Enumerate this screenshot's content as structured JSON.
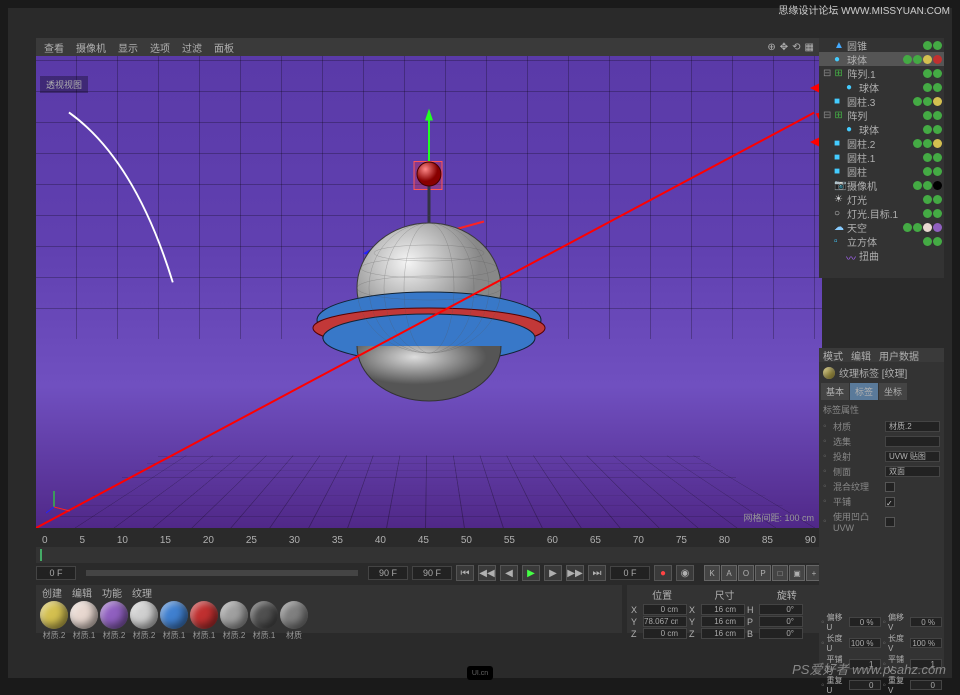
{
  "watermarks": {
    "top_right": "思缘设计论坛 WWW.MISSYUAN.COM",
    "bottom_right": "PS爱好者 www.psahz.com",
    "bottom_center": "UI.cn"
  },
  "menubar": {
    "items": [
      "查看",
      "摄像机",
      "显示",
      "选项",
      "过滤",
      "面板"
    ]
  },
  "viewport": {
    "label": "透视视图",
    "grid_info": "网格间距: 100 cm"
  },
  "timeline": {
    "start": "0 F",
    "end": "90 F",
    "current": "0 F",
    "ticks": [
      "0",
      "5",
      "10",
      "15",
      "20",
      "25",
      "30",
      "35",
      "40",
      "45",
      "50",
      "55",
      "60",
      "65",
      "70",
      "75",
      "80",
      "85",
      "90"
    ]
  },
  "playback_toggles": [
    "K",
    "A",
    "O",
    "P",
    "□",
    "▣",
    "+"
  ],
  "materials": {
    "tabs": [
      "创建",
      "编辑",
      "功能",
      "纹理"
    ],
    "items": [
      {
        "name": "材质.2",
        "color": "#d4c050"
      },
      {
        "name": "材质.1",
        "color": "#e8d8d0"
      },
      {
        "name": "材质.2",
        "color": "#9060c0"
      },
      {
        "name": "材质.2",
        "color": "#d0d0d0"
      },
      {
        "name": "材质.1",
        "color": "#4080d0"
      },
      {
        "name": "材质.1",
        "color": "#c03030"
      },
      {
        "name": "材质.2",
        "color": "#a0a0a0"
      },
      {
        "name": "材质.1",
        "color": "#505050"
      },
      {
        "name": "材质",
        "color": "#808080"
      }
    ]
  },
  "coords": {
    "headers": [
      "位置",
      "尺寸",
      "旋转"
    ],
    "rows": [
      {
        "axis": "X",
        "pos": "0 cm",
        "size": "16 cm",
        "rot": "H",
        "rotval": "0°"
      },
      {
        "axis": "Y",
        "pos": "78.067 cm",
        "size": "16 cm",
        "rot": "P",
        "rotval": "0°"
      },
      {
        "axis": "Z",
        "pos": "0 cm",
        "size": "16 cm",
        "rot": "B",
        "rotval": "0°"
      }
    ]
  },
  "hierarchy": [
    {
      "icon": "▲",
      "color": "#4af",
      "name": "圆锥",
      "indent": 0,
      "tags": [
        "#4a4",
        "#4a4"
      ]
    },
    {
      "icon": "●",
      "color": "#4cf",
      "name": "球体",
      "indent": 0,
      "sel": true,
      "tags": [
        "#4a4",
        "#4a4",
        "#d4c050",
        "#c03030"
      ]
    },
    {
      "icon": "⊞",
      "color": "#4a4",
      "name": "阵列.1",
      "indent": 0,
      "exp": true,
      "tags": [
        "#4a4",
        "#4a4"
      ]
    },
    {
      "icon": "●",
      "color": "#4cf",
      "name": "球体",
      "indent": 1,
      "tags": [
        "#4a4",
        "#4a4"
      ]
    },
    {
      "icon": "■",
      "color": "#4cf",
      "name": "圆柱.3",
      "indent": 0,
      "tags": [
        "#4a4",
        "#4a4",
        "#d4c050"
      ]
    },
    {
      "icon": "⊞",
      "color": "#4a4",
      "name": "阵列",
      "indent": 0,
      "exp": true,
      "tags": [
        "#4a4",
        "#4a4"
      ]
    },
    {
      "icon": "●",
      "color": "#4cf",
      "name": "球体",
      "indent": 1,
      "tags": [
        "#4a4",
        "#4a4"
      ]
    },
    {
      "icon": "■",
      "color": "#4cf",
      "name": "圆柱.2",
      "indent": 0,
      "tags": [
        "#4a4",
        "#4a4",
        "#d4c050"
      ]
    },
    {
      "icon": "■",
      "color": "#4cf",
      "name": "圆柱.1",
      "indent": 0,
      "tags": [
        "#4a4",
        "#4a4"
      ]
    },
    {
      "icon": "■",
      "color": "#4cf",
      "name": "圆柱",
      "indent": 0,
      "tags": [
        "#4a4",
        "#4a4"
      ]
    },
    {
      "icon": "📷",
      "color": "#ccc",
      "name": "摄像机",
      "indent": 0,
      "tags": [
        "#4a4",
        "#4a4",
        "#000"
      ]
    },
    {
      "icon": "☀",
      "color": "#ccc",
      "name": "灯光",
      "indent": 0,
      "tags": [
        "#4a4",
        "#4a4"
      ]
    },
    {
      "icon": "○",
      "color": "#ccc",
      "name": "灯光.目标.1",
      "indent": 0,
      "tags": [
        "#4a4",
        "#4a4"
      ]
    },
    {
      "icon": "☁",
      "color": "#8cf",
      "name": "天空",
      "indent": 0,
      "tags": [
        "#4a4",
        "#4a4",
        "#e8d8d0",
        "#9060c0"
      ]
    },
    {
      "icon": "▫",
      "color": "#4cf",
      "name": "立方体",
      "indent": 0,
      "tags": [
        "#4a4",
        "#4a4"
      ]
    },
    {
      "icon": "〰",
      "color": "#a6f",
      "name": "扭曲",
      "indent": 1,
      "tags": []
    }
  ],
  "attributes": {
    "header_tabs": [
      "模式",
      "编辑",
      "用户数据"
    ],
    "title": "纹理标签 [纹理]",
    "tabs": [
      "基本",
      "标签",
      "坐标"
    ],
    "active_tab": "标签",
    "section": "标签属性",
    "rows": [
      {
        "label": "材质",
        "value": "材质.2",
        "type": "field"
      },
      {
        "label": "选集",
        "value": "",
        "type": "field"
      },
      {
        "label": "投射",
        "value": "UVW 贴图",
        "type": "field"
      },
      {
        "label": "侧面",
        "value": "双面",
        "type": "field"
      },
      {
        "label": "混合纹理",
        "value": "",
        "type": "check",
        "checked": false
      },
      {
        "label": "平铺",
        "value": "",
        "type": "check",
        "checked": true
      },
      {
        "label": "使用凹凸 UVW",
        "value": "",
        "type": "check",
        "checked": false
      }
    ]
  },
  "ext_attrs": [
    {
      "l1": "偏移 U",
      "v1": "0 %",
      "l2": "偏移 V",
      "v2": "0 %"
    },
    {
      "l1": "长度 U",
      "v1": "100 %",
      "l2": "长度 V",
      "v2": "100 %"
    },
    {
      "l1": "平铺 U",
      "v1": "1",
      "l2": "平铺 V",
      "v2": "1"
    },
    {
      "l1": "重复 U",
      "v1": "0",
      "l2": "重复 V",
      "v2": "0"
    }
  ]
}
